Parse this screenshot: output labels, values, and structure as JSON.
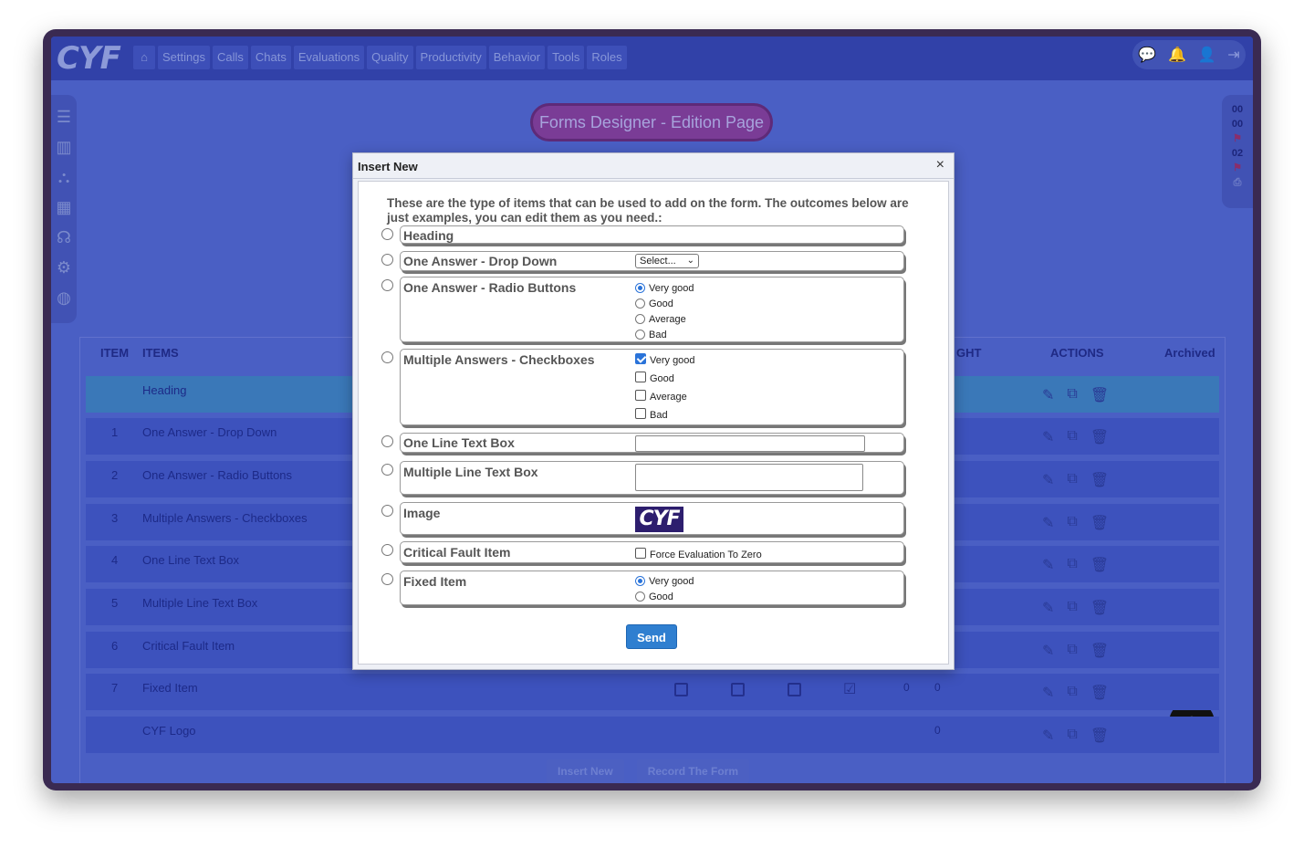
{
  "app": {
    "logo": "CYF",
    "nav": [
      "Settings",
      "Calls",
      "Chats",
      "Evaluations",
      "Quality",
      "Productivity",
      "Behavior",
      "Tools",
      "Roles"
    ],
    "home_icon": "⌂",
    "page_title": "Forms Designer - Edition Page",
    "right_panel": [
      "00",
      "00",
      "02"
    ]
  },
  "table": {
    "headers": {
      "item": "ITEM",
      "items": "ITEMS",
      "weight": "GHT",
      "actions": "ACTIONS",
      "archived": "Archived"
    },
    "rows": [
      {
        "idx": "",
        "name": "Heading"
      },
      {
        "idx": "1",
        "name": "One Answer - Drop Down"
      },
      {
        "idx": "2",
        "name": "One Answer - Radio Buttons"
      },
      {
        "idx": "3",
        "name": "Multiple Answers - Checkboxes"
      },
      {
        "idx": "4",
        "name": "One Line Text Box"
      },
      {
        "idx": "5",
        "name": "Multiple Line Text Box"
      },
      {
        "idx": "6",
        "name": "Critical Fault Item"
      },
      {
        "idx": "7",
        "name": "Fixed Item"
      },
      {
        "idx": "",
        "name": "CYF Logo"
      }
    ],
    "fixed_values": [
      "0",
      "0"
    ],
    "logo_value": "0",
    "buttons": {
      "insert": "Insert New",
      "record": "Record The Form"
    }
  },
  "modal": {
    "title": "Insert New",
    "close": "×",
    "intro": "These are the type of items that can be used to add on the form. The outcomes below are just examples, you can edit them as you need.:",
    "options": {
      "heading": "Heading",
      "dropdown": "One Answer - Drop Down",
      "dropdown_value": "Select...",
      "radio": "One Answer - Radio Buttons",
      "radio_choices": [
        "Very good",
        "Good",
        "Average",
        "Bad"
      ],
      "checkbox": "Multiple Answers - Checkboxes",
      "checkbox_choices": [
        "Very good",
        "Good",
        "Average",
        "Bad"
      ],
      "oneline": "One Line Text Box",
      "multiline": "Multiple Line Text Box",
      "image": "Image",
      "image_text": "CYF",
      "critical": "Critical Fault Item",
      "critical_check": "Force Evaluation To Zero",
      "fixed": "Fixed Item",
      "fixed_choices": [
        "Very good",
        "Good"
      ]
    },
    "send": "Send"
  }
}
